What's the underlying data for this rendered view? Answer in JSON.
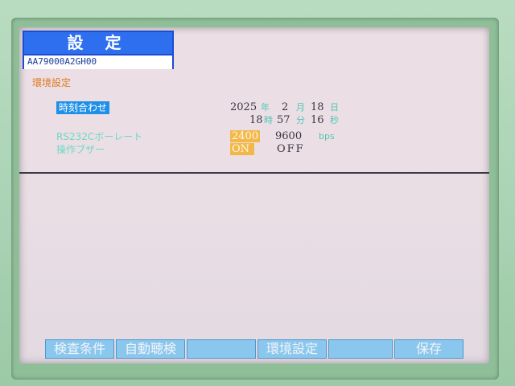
{
  "screen": {
    "title": "設 定",
    "model_code": "AA79000A2GH00",
    "section_heading": "環境設定"
  },
  "settings": {
    "time_label": "時刻合わせ",
    "baud_label": "RS232Cボーレート",
    "beep_label": "操作ブザー",
    "date": {
      "year": "2025",
      "year_unit": "年",
      "month": "2",
      "month_unit": "月",
      "day": "18",
      "day_unit": "日"
    },
    "time": {
      "hour": "18",
      "hour_unit": "時",
      "minute": "57",
      "minute_unit": "分",
      "second": "16",
      "second_unit": "秒"
    },
    "baud_options": [
      "2400",
      "9600",
      "bps"
    ],
    "baud_selected": "2400",
    "beep_options": [
      "ON",
      "OFF"
    ],
    "beep_selected": "ON"
  },
  "softkeys": [
    "検査条件",
    "自動聴検",
    "",
    "環境設定",
    "",
    "保存"
  ],
  "colors": {
    "screen_bg": "#ebdfe5",
    "title_bg": "#2e6ff0",
    "heading": "#e07a20",
    "label_highlight": "#1e90e8",
    "unit": "#4fc7b4",
    "selection": "#f2b84a",
    "softkey_bg": "#7fc9f3"
  }
}
